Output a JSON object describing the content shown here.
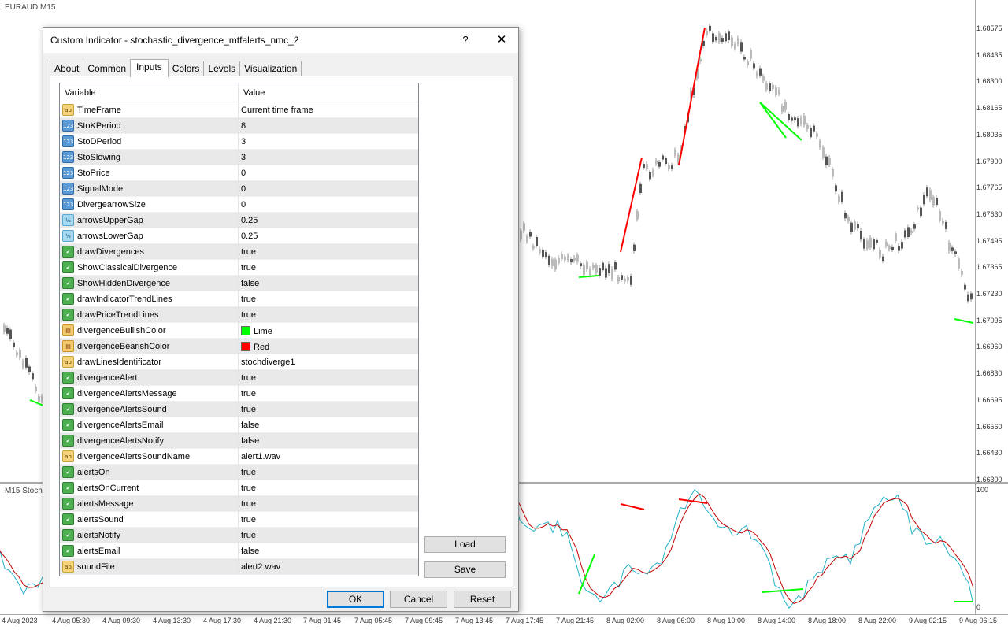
{
  "chart": {
    "symbol": "EURAUD,M15",
    "sub_window_label": "M15 Stocha",
    "price_levels": [
      "1.68575",
      "1.68435",
      "1.68300",
      "1.68165",
      "1.68035",
      "1.67900",
      "1.67765",
      "1.67630",
      "1.67495",
      "1.67365",
      "1.67230",
      "1.67095",
      "1.66960",
      "1.66830",
      "1.66695",
      "1.66560",
      "1.66430",
      "1.66300"
    ],
    "sub_levels": [
      "100",
      "0"
    ],
    "time_labels": [
      "4 Aug 2023",
      "4 Aug 05:30",
      "4 Aug 09:30",
      "4 Aug 13:30",
      "4 Aug 17:30",
      "4 Aug 21:30",
      "7 Aug 01:45",
      "7 Aug 05:45",
      "7 Aug 09:45",
      "7 Aug 13:45",
      "7 Aug 17:45",
      "7 Aug 21:45",
      "8 Aug 02:00",
      "8 Aug 06:00",
      "8 Aug 10:00",
      "8 Aug 14:00",
      "8 Aug 18:00",
      "8 Aug 22:00",
      "9 Aug 02:15",
      "9 Aug 06:15"
    ],
    "colors": {
      "bull": "#00ff00",
      "bear": "#ff0000",
      "stoch_main": "#20b2c8",
      "stoch_signal": "#c00000"
    }
  },
  "dialog": {
    "title": "Custom Indicator - stochastic_divergence_mtfalerts_nmc_2",
    "help_icon": "?",
    "close_icon": "✕",
    "tabs": [
      {
        "label": "About"
      },
      {
        "label": "Common"
      },
      {
        "label": "Inputs"
      },
      {
        "label": "Colors"
      },
      {
        "label": "Levels"
      },
      {
        "label": "Visualization"
      }
    ],
    "active_tab": "Inputs",
    "grid": {
      "col_variable": "Variable",
      "col_value": "Value",
      "rows": [
        {
          "icon": "str",
          "name": "TimeFrame",
          "value": "Current time frame"
        },
        {
          "icon": "int",
          "name": "StoKPeriod",
          "value": "8"
        },
        {
          "icon": "int",
          "name": "StoDPeriod",
          "value": "3"
        },
        {
          "icon": "int",
          "name": "StoSlowing",
          "value": "3"
        },
        {
          "icon": "int",
          "name": "StoPrice",
          "value": "0"
        },
        {
          "icon": "int",
          "name": "SignalMode",
          "value": "0"
        },
        {
          "icon": "int",
          "name": "DivergearrowSize",
          "value": "0"
        },
        {
          "icon": "dbl",
          "name": "arrowsUpperGap",
          "value": "0.25"
        },
        {
          "icon": "dbl",
          "name": "arrowsLowerGap",
          "value": "0.25"
        },
        {
          "icon": "bool",
          "name": "drawDivergences",
          "value": "true"
        },
        {
          "icon": "bool",
          "name": "ShowClassicalDivergence",
          "value": "true"
        },
        {
          "icon": "bool",
          "name": "ShowHiddenDivergence",
          "value": "false"
        },
        {
          "icon": "bool",
          "name": "drawIndicatorTrendLines",
          "value": "true"
        },
        {
          "icon": "bool",
          "name": "drawPriceTrendLines",
          "value": "true"
        },
        {
          "icon": "color",
          "name": "divergenceBullishColor",
          "value": "Lime",
          "swatch": "#00ff00"
        },
        {
          "icon": "color",
          "name": "divergenceBearishColor",
          "value": "Red",
          "swatch": "#ff0000"
        },
        {
          "icon": "str",
          "name": "drawLinesIdentificator",
          "value": "stochdiverge1"
        },
        {
          "icon": "bool",
          "name": "divergenceAlert",
          "value": "true"
        },
        {
          "icon": "bool",
          "name": "divergenceAlertsMessage",
          "value": "true"
        },
        {
          "icon": "bool",
          "name": "divergenceAlertsSound",
          "value": "true"
        },
        {
          "icon": "bool",
          "name": "divergenceAlertsEmail",
          "value": "false"
        },
        {
          "icon": "bool",
          "name": "divergenceAlertsNotify",
          "value": "false"
        },
        {
          "icon": "str",
          "name": "divergenceAlertsSoundName",
          "value": "alert1.wav"
        },
        {
          "icon": "bool",
          "name": "alertsOn",
          "value": "true"
        },
        {
          "icon": "bool",
          "name": "alertsOnCurrent",
          "value": "true"
        },
        {
          "icon": "bool",
          "name": "alertsMessage",
          "value": "true"
        },
        {
          "icon": "bool",
          "name": "alertsSound",
          "value": "true"
        },
        {
          "icon": "bool",
          "name": "alertsNotify",
          "value": "true"
        },
        {
          "icon": "bool",
          "name": "alertsEmail",
          "value": "false"
        },
        {
          "icon": "str",
          "name": "soundFile",
          "value": "alert2.wav"
        }
      ]
    },
    "buttons": {
      "load": "Load",
      "save": "Save",
      "ok": "OK",
      "cancel": "Cancel",
      "reset": "Reset"
    },
    "icon_glyphs": {
      "int": "123",
      "dbl": "½",
      "bool": "✔",
      "str": "ab",
      "color": "▤"
    }
  }
}
